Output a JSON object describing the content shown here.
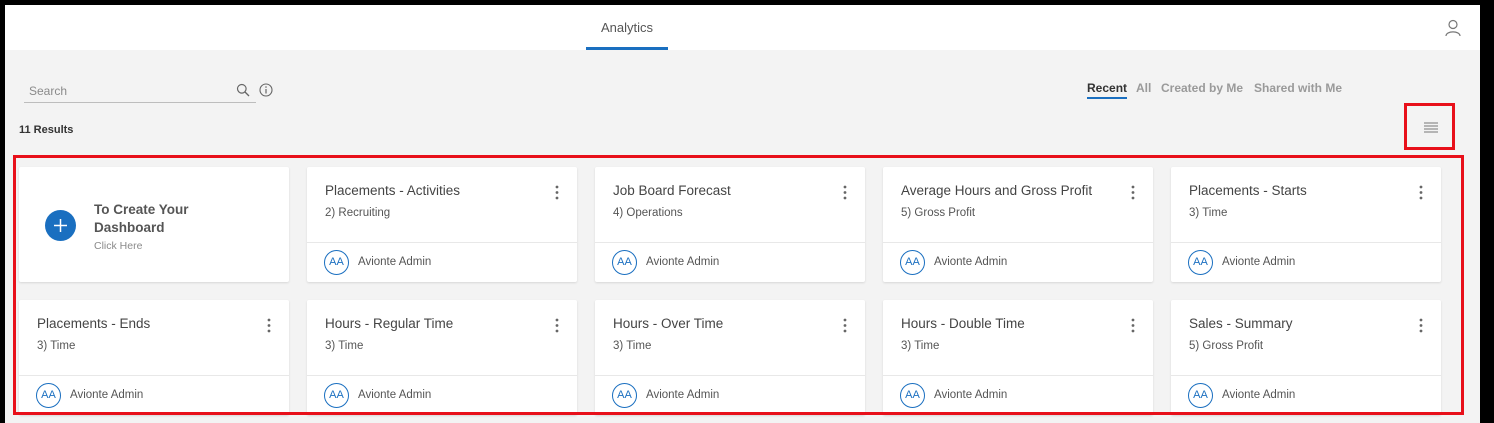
{
  "header": {
    "active_tab": "Analytics",
    "user_icon": "user-icon"
  },
  "search": {
    "placeholder": "Search",
    "value": "",
    "search_icon": "search-icon",
    "info_icon": "info-icon"
  },
  "filters": [
    {
      "label": "Recent",
      "active": true
    },
    {
      "label": "All",
      "active": false
    },
    {
      "label": "Created by Me",
      "active": false
    },
    {
      "label": "Shared with Me",
      "active": false
    }
  ],
  "results": {
    "count_text": "11 Results"
  },
  "view_toggle": {
    "icon": "list-view-icon"
  },
  "create_card": {
    "title": "To Create Your Dashboard",
    "subtitle": "Click Here",
    "icon": "plus-icon"
  },
  "dashboards": [
    {
      "title": "Placements - Activities",
      "category": "2) Recruiting",
      "owner_initials": "AA",
      "owner": "Avionte Admin"
    },
    {
      "title": "Job Board Forecast",
      "category": "4) Operations",
      "owner_initials": "AA",
      "owner": "Avionte Admin"
    },
    {
      "title": "Average Hours and Gross Profit",
      "category": "5) Gross Profit",
      "owner_initials": "AA",
      "owner": "Avionte Admin"
    },
    {
      "title": "Placements - Starts",
      "category": "3) Time",
      "owner_initials": "AA",
      "owner": "Avionte Admin"
    },
    {
      "title": "Placements - Ends",
      "category": "3) Time",
      "owner_initials": "AA",
      "owner": "Avionte Admin"
    },
    {
      "title": "Hours - Regular Time",
      "category": "3) Time",
      "owner_initials": "AA",
      "owner": "Avionte Admin"
    },
    {
      "title": "Hours - Over Time",
      "category": "3) Time",
      "owner_initials": "AA",
      "owner": "Avionte Admin"
    },
    {
      "title": "Hours - Double Time",
      "category": "3) Time",
      "owner_initials": "AA",
      "owner": "Avionte Admin"
    },
    {
      "title": "Sales - Summary",
      "category": "5) Gross Profit",
      "owner_initials": "AA",
      "owner": "Avionte Admin"
    }
  ],
  "colors": {
    "accent": "#1a6fc0",
    "highlight_border": "#e8101a",
    "page_background": "#f3f3f3"
  }
}
